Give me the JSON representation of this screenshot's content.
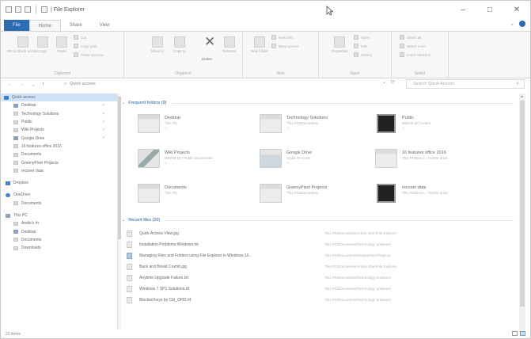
{
  "window": {
    "title": "| File Explorer",
    "controls": {
      "minimize": "–",
      "maximize": "□",
      "close": "✕"
    }
  },
  "ribbon": {
    "tabs": [
      {
        "label": "File",
        "state": "file"
      },
      {
        "label": "Home",
        "state": "active"
      },
      {
        "label": "Share",
        "state": "normal"
      },
      {
        "label": "View",
        "state": "normal"
      }
    ],
    "collapse_glyph": "⌄",
    "groups": {
      "clipboard": {
        "label": "Clipboard",
        "pin": "Pin to Quick access",
        "copy": "Copy",
        "paste": "Paste",
        "cut": "Cut",
        "copy_path": "Copy path",
        "paste_shortcut": "Paste shortcut"
      },
      "organize": {
        "label": "Organize",
        "move_to": "Move to",
        "copy_to": "Copy to",
        "delete": "Delete",
        "rename": "Rename"
      },
      "new": {
        "label": "New",
        "new_folder": "New folder",
        "new_item": "New item",
        "easy_access": "Easy access"
      },
      "open": {
        "label": "Open",
        "properties": "Properties",
        "open": "Open",
        "edit": "Edit",
        "history": "History"
      },
      "select": {
        "label": "Select",
        "select_all": "Select all",
        "select_none": "Select none",
        "invert_selection": "Invert selection"
      }
    }
  },
  "address": {
    "back": "←",
    "forward": "→",
    "up_arrow": "↑",
    "location_prefix": "» ",
    "location": "Quick access",
    "dropdown": "⌄",
    "refresh": "⟳",
    "search_placeholder": "Search Quick Access",
    "search_glyph": "⌕"
  },
  "nav": {
    "items": [
      {
        "label": "Quick access",
        "icon": "star",
        "pinned": false,
        "selected": true,
        "indent": 4
      },
      {
        "label": "Desktop",
        "icon": "drive",
        "pinned": true,
        "indent": 16
      },
      {
        "label": "Technology Solutions",
        "icon": "folder",
        "pinned": true,
        "indent": 16
      },
      {
        "label": "Public",
        "icon": "folder",
        "pinned": true,
        "indent": 16
      },
      {
        "label": "Wiki Projects",
        "icon": "folder",
        "pinned": true,
        "indent": 16
      },
      {
        "label": "Google Drive",
        "icon": "drive",
        "pinned": true,
        "indent": 16
      },
      {
        "label": "16 features office 2016",
        "icon": "folder",
        "pinned": false,
        "indent": 16
      },
      {
        "label": "Documents",
        "icon": "folder",
        "pinned": false,
        "indent": 16
      },
      {
        "label": "GreenyPixel Projects",
        "icon": "folder",
        "pinned": false,
        "indent": 16
      },
      {
        "label": "recover data",
        "icon": "folder",
        "pinned": false,
        "indent": 16
      },
      {
        "gap": true
      },
      {
        "label": "Dropbox",
        "icon": "dropbox",
        "pinned": false,
        "indent": 6
      },
      {
        "gap": true
      },
      {
        "label": "OneDrive",
        "icon": "cloud",
        "pinned": false,
        "indent": 6
      },
      {
        "label": "Documents",
        "icon": "folder",
        "pinned": false,
        "indent": 16
      },
      {
        "gap": true
      },
      {
        "label": "This PC",
        "icon": "drive",
        "pinned": false,
        "indent": 6
      },
      {
        "label": "Andie's rh",
        "icon": "folder",
        "pinned": false,
        "indent": 16
      },
      {
        "label": "Desktop",
        "icon": "drive",
        "pinned": false,
        "indent": 16
      },
      {
        "label": "Documents",
        "icon": "folder",
        "pinned": false,
        "indent": 16
      },
      {
        "label": "Downloads",
        "icon": "folder",
        "pinned": false,
        "indent": 16
      }
    ],
    "pin_glyph": "✓"
  },
  "frequent": {
    "heading": "Frequent folders (9)",
    "chevron": "⌄",
    "pin_glyph": "✓",
    "tiles": [
      {
        "name": "Desktop",
        "sub": "This PC",
        "thumb": "folder",
        "pinned": true
      },
      {
        "name": "Technology Solutions",
        "sub": "This PC\\Documents",
        "thumb": "folder",
        "pinned": true
      },
      {
        "name": "Public",
        "sub": "MINHE (E:) Users",
        "thumb": "dark",
        "pinned": true
      },
      {
        "name": "Wiki Projects",
        "sub": "MINHE (E:) Public Documents",
        "thumb": "img",
        "pinned": true
      },
      {
        "name": "Google Drive",
        "sub": "Andie On Core",
        "thumb": "drive",
        "pinned": true
      },
      {
        "name": "16 features office 2016",
        "sub": "This PC\\Docu... \\Article drive",
        "thumb": "folder",
        "pinned": false
      },
      {
        "name": "Documents",
        "sub": "This PC",
        "thumb": "folder",
        "pinned": false
      },
      {
        "name": "GreenyPixel Projects",
        "sub": "This PC\\Documents",
        "thumb": "folder",
        "pinned": false
      },
      {
        "name": "recover data",
        "sub": "This PC\\Docu... \\Article drive",
        "thumb": "dark",
        "pinned": false
      }
    ]
  },
  "recent": {
    "heading": "Recent files (20)",
    "chevron": "⌄",
    "files": [
      {
        "name": "Quick Access View.jpg",
        "path": "This PC\\Documents\\Article drive\\File Explorer",
        "icon": "doc"
      },
      {
        "name": "Installation Problems Windows.txt",
        "path": "This PC\\Documents\\Technology Solutions",
        "icon": "doc"
      },
      {
        "name": "Managing Files and Folders using File Explorer in Windows 10...",
        "path": "This PC\\Documents\\GreenyPixel Projects",
        "icon": "blue"
      },
      {
        "name": "Back and Bread Crumb.jpg",
        "path": "This PC\\Documents\\Article drive\\File Explorer",
        "icon": "doc"
      },
      {
        "name": "Anytime Upgrade Failure.txt",
        "path": "This PC\\Documents\\Technology Solutions",
        "icon": "doc"
      },
      {
        "name": "Windows 7 SP1 Solutions.rtf",
        "path": "This PC\\Documents\\Technology Solutions",
        "icon": "doc"
      },
      {
        "name": "Blocked keys by Ctrl_OHD.rtf",
        "path": "This PC\\Documents\\Technology Solutions",
        "icon": "doc"
      }
    ]
  },
  "status": {
    "items_count": "23 items"
  }
}
